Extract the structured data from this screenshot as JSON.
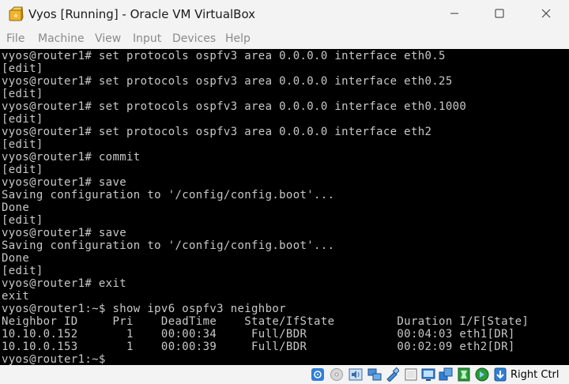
{
  "window": {
    "title": "Vyos [Running] - Oracle VM VirtualBox",
    "minimize_icon": "minimize-icon",
    "maximize_icon": "maximize-icon",
    "close_icon": "close-icon"
  },
  "menubar": {
    "items": [
      "File",
      "Machine",
      "View",
      "Input",
      "Devices",
      "Help"
    ]
  },
  "terminal": {
    "lines": [
      "vyos@router1# set protocols ospfv3 area 0.0.0.0 interface eth0.5",
      "[edit]",
      "vyos@router1# set protocols ospfv3 area 0.0.0.0 interface eth0.25",
      "[edit]",
      "vyos@router1# set protocols ospfv3 area 0.0.0.0 interface eth0.1000",
      "[edit]",
      "vyos@router1# set protocols ospfv3 area 0.0.0.0 interface eth2",
      "[edit]",
      "vyos@router1# commit",
      "[edit]",
      "vyos@router1# save",
      "Saving configuration to '/config/config.boot'...",
      "Done",
      "[edit]",
      "vyos@router1# save",
      "Saving configuration to '/config/config.boot'...",
      "Done",
      "[edit]",
      "vyos@router1# exit",
      "exit",
      "vyos@router1:~$ show ipv6 ospfv3 neighbor",
      "Neighbor ID     Pri    DeadTime    State/IfState         Duration I/F[State]",
      "10.10.0.152       1    00:00:34     Full/BDR             00:04:03 eth1[DR]",
      "10.10.0.153       1    00:00:39     Full/BDR             00:02:09 eth2[DR]",
      "vyos@router1:~$"
    ]
  },
  "statusbar": {
    "icons": [
      "hard-disk-icon",
      "optical-drive-icon",
      "audio-icon",
      "network-icon",
      "usb-icon",
      "shared-folder-icon",
      "display-icon",
      "video-capture-icon",
      "recording-icon",
      "cpu-icon",
      "mouse-integration-icon",
      "keyboard-capture-icon"
    ],
    "host_key": "Right Ctrl"
  },
  "colors": {
    "terminal_bg": "#000000",
    "terminal_fg": "#c8c8c8",
    "chrome_bg": "#f3f3f3"
  }
}
